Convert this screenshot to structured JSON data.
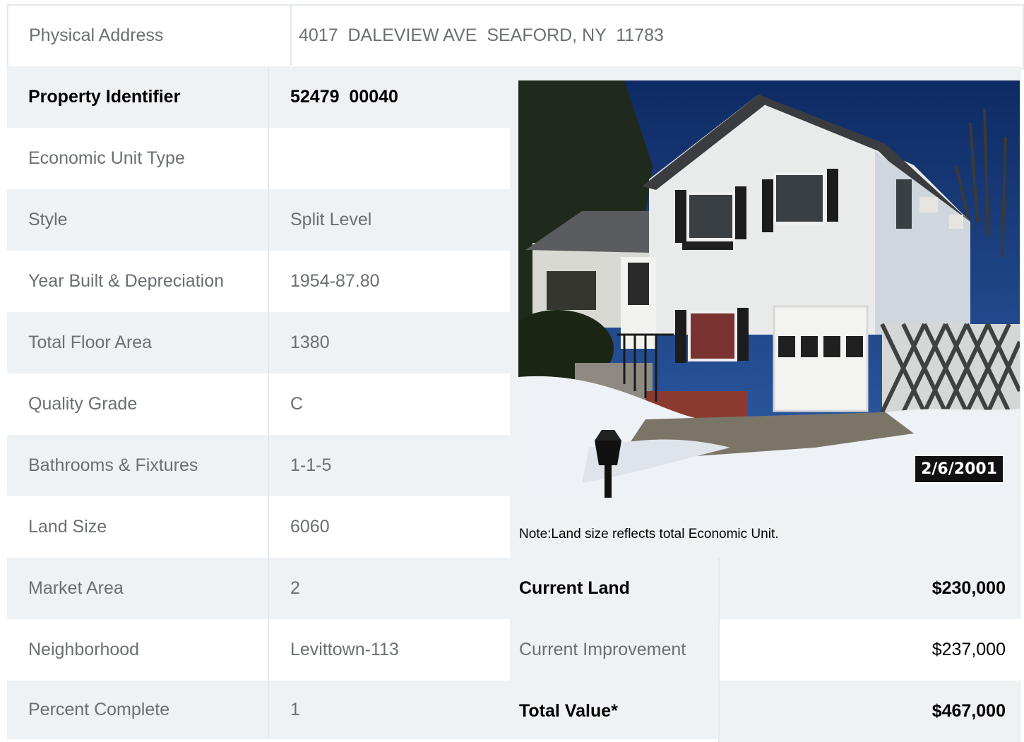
{
  "address": {
    "label": "Physical Address",
    "value": "4017  DALEVIEW AVE  SEAFORD, NY  11783"
  },
  "rows": [
    {
      "label": "Property Identifier",
      "value": "52479  00040"
    },
    {
      "label": "Economic Unit Type",
      "value": ""
    },
    {
      "label": "Style",
      "value": "Split Level"
    },
    {
      "label": "Year Built & Depreciation",
      "value": "1954-87.80"
    },
    {
      "label": "Total Floor Area",
      "value": "1380"
    },
    {
      "label": "Quality Grade",
      "value": "C"
    },
    {
      "label": "Bathrooms & Fixtures",
      "value": "1-1-5"
    },
    {
      "label": "Land Size",
      "value": "6060"
    },
    {
      "label": "Market Area",
      "value": "2"
    },
    {
      "label": "Neighborhood",
      "value": "Levittown-113"
    },
    {
      "label": "Percent Complete",
      "value": "1"
    }
  ],
  "photo": {
    "date_stamp": "2/6/2001"
  },
  "note": "Note:Land size reflects total Economic Unit.",
  "values": [
    {
      "label": "Current Land",
      "amount": "$230,000"
    },
    {
      "label": "Current Improvement",
      "amount": "$237,000"
    },
    {
      "label": "Total Value*",
      "amount": "$467,000"
    }
  ]
}
